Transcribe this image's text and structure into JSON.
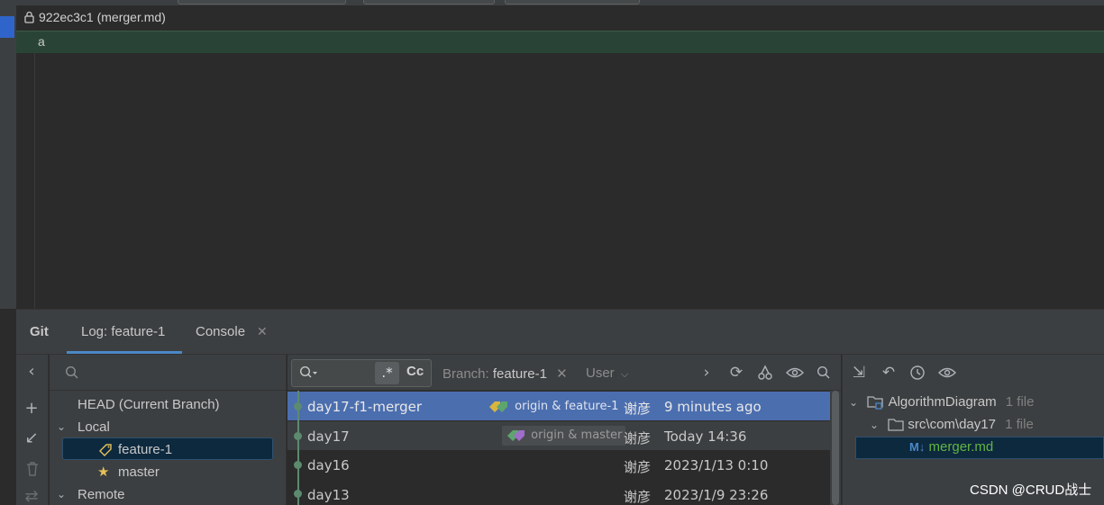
{
  "file": {
    "title": "922ec3c1 (merger.md)"
  },
  "editor": {
    "line_text": "a"
  },
  "tool_tabs": {
    "git": "Git",
    "log": "Log: feature-1",
    "console": "Console"
  },
  "branches": {
    "head": "HEAD (Current Branch)",
    "local_label": "Local",
    "local": [
      "feature-1",
      "master"
    ],
    "remote_label": "Remote"
  },
  "log_toolbar": {
    "regex": ".*",
    "case": "Cc",
    "branch_label": "Branch:",
    "branch_value": "feature-1",
    "user_label": "User"
  },
  "commits": [
    {
      "message": "day17-f1-merger",
      "refs": "origin & feature-1",
      "author": "谢彦",
      "date": "9 minutes ago"
    },
    {
      "message": "day17",
      "refs": "origin & master",
      "author": "谢彦",
      "date": "Today 14:36"
    },
    {
      "message": "day16",
      "refs": "",
      "author": "谢彦",
      "date": "2023/1/13 0:10"
    },
    {
      "message": "day13",
      "refs": "",
      "author": "谢彦",
      "date": "2023/1/9 23:26"
    }
  ],
  "changes": {
    "root": "AlgorithmDiagram",
    "root_count": "1 file",
    "folder": "src\\com\\day17",
    "folder_count": "1 file",
    "file": "merger.md",
    "file_badge": "M↓"
  },
  "colors": {
    "accent": "#4b6eaf",
    "added_line": "#294436",
    "tag_yellow": "#d8b53f",
    "tag_green": "#5da56e"
  },
  "watermark": "CSDN @CRUD战士"
}
